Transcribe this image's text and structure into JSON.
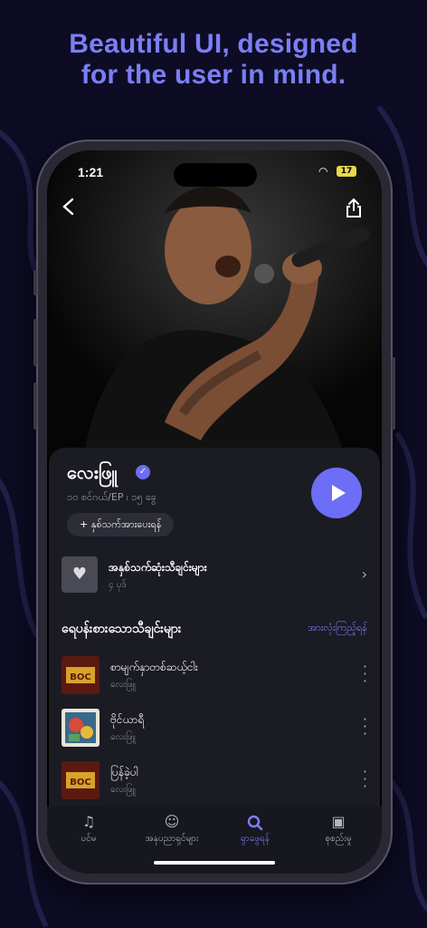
{
  "headline": {
    "line1": "Beautiful UI, designed",
    "line2": "for the user in mind."
  },
  "status_bar": {
    "time": "1:21",
    "battery": "17"
  },
  "artist": {
    "name": "လေးဖြူ",
    "stats": "၁၀ စင်ဂယ်/EP  ၊  ၁၅ ခွေ",
    "follow_label": "+  နှစ်သက်အားပေးရန်"
  },
  "liked_songs": {
    "title": "အနှစ်သက်ဆုံးသီချင်းများ",
    "count": "၄ ပုဒ်"
  },
  "popular": {
    "title": "ရေပန်းစားသောသီချင်းများ",
    "see_all": "အားလုံးကြည့်ရန်",
    "songs": [
      {
        "title": "စာမျက်နှာတစ်ဆယ့်ငါး",
        "artist": "လေးဖြူ"
      },
      {
        "title": "ဗိုင်ယာရီ",
        "artist": "လေးဖြူ"
      },
      {
        "title": "ပြန်ခဲ့ပါ",
        "artist": "လေးဖြူ"
      }
    ]
  },
  "tabs": [
    {
      "label": "ပင်မ",
      "icon": "music-note-icon"
    },
    {
      "label": "အနုပညာရှင်များ",
      "icon": "artist-face-icon"
    },
    {
      "label": "ရှာဖွေရန်",
      "icon": "search-icon"
    },
    {
      "label": "စုစည်းမှု",
      "icon": "library-icon"
    }
  ],
  "colors": {
    "accent": "#6c6ff5",
    "card": "#1b1b24",
    "background": "#0d0c24"
  }
}
